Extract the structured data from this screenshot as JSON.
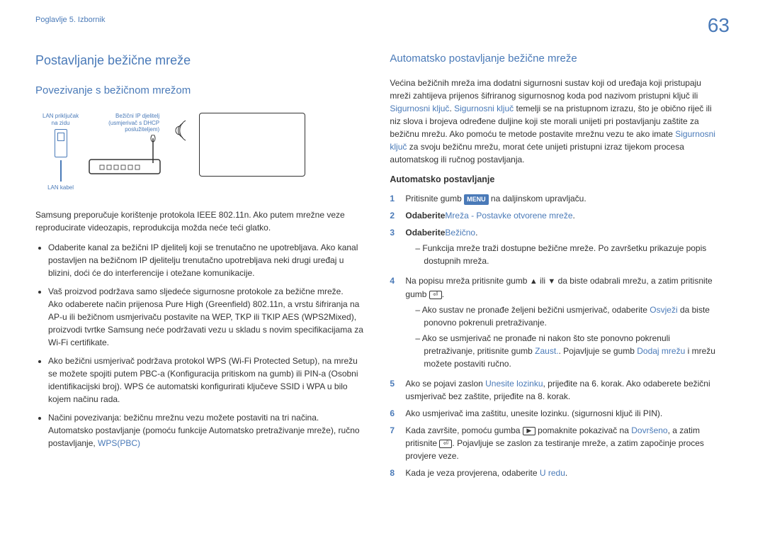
{
  "page_number": "63",
  "breadcrumb": "Poglavlje 5. Izbornik",
  "left": {
    "h1": "Postavljanje bežične mreže",
    "h2": "Povezivanje s bežičnom mrežom",
    "diagram": {
      "lan_wall": "LAN priključak",
      "lan_wall2": "na zidu",
      "router1": "Bežični IP djelitelj",
      "router2": "(usmjerivač s DHCP",
      "router3": "poslužiteljem)",
      "lan_cable": "LAN kabel"
    },
    "intro": "Samsung preporučuje korištenje protokola IEEE 802.11n. Ako putem mrežne veze reproducirate videozapis, reprodukcija možda neće teći glatko.",
    "bullets": [
      "Odaberite kanal za bežični IP djelitelj koji se trenutačno ne upotrebljava. Ako kanal postavljen na bežičnom IP djelitelju trenutačno upotrebljava neki drugi uređaj u blizini, doći će do interferencije i otežane komunikacije.",
      "Vaš proizvod podržava samo sljedeće sigurnosne protokole za bežične mreže.\nAko odaberete način prijenosa Pure High (Greenfield) 802.11n, a vrstu šifriranja na AP-u ili bežičnom usmjerivaču postavite na WEP, TKP ili TKIP AES (WPS2Mixed), proizvodi tvrtke Samsung neće podržavati vezu u skladu s novim specifikacijama za Wi-Fi certifikate.",
      "Ako bežični usmjerivač podržava protokol WPS (Wi-Fi Protected Setup), na mrežu se možete spojiti putem PBC-a (Konfiguracija pritiskom na gumb) ili PIN-a (Osobni identifikacijski broj). WPS će automatski konfigurirati ključeve SSID i WPA u bilo kojem načinu rada."
    ],
    "bullet4_pre": "Načini povezivanja: bežičnu mrežnu vezu možete postaviti na tri načina.\nAutomatsko postavljanje (pomoću funkcije Automatsko pretraživanje mreže), ručno postavljanje, ",
    "bullet4_hl": "WPS(PBC)"
  },
  "right": {
    "h2": "Automatsko postavljanje bežične mreže",
    "para_pre": "Većina bežičnih mreža ima dodatni sigurnosni sustav koji od uređaja koji pristupaju mreži zahtijeva prijenos šifriranog sigurnosnog koda pod nazivom pristupni ključ ili ",
    "para_hl1": "Sigurnosni ključ",
    "para_mid1": ". ",
    "para_hl2": "Sigurnosni ključ",
    "para_mid2": " temelji se na pristupnom izrazu, što je obično riječ ili niz slova i brojeva određene duljine koji ste morali unijeti pri postavljanju zaštite za bežičnu mrežu. Ako pomoću te metode postavite mrežnu vezu te ako imate ",
    "para_hl3": "Sigurnosni ključ",
    "para_end": " za svoju bežičnu mrežu, morat ćete unijeti pristupni izraz tijekom procesa automatskog ili ručnog postavljanja.",
    "h3": "Automatsko postavljanje",
    "step1_pre": "Pritisnite gumb ",
    "step1_btn": "MENU",
    "step1_post": " na daljinskom upravljaču.",
    "step2_bold": "Odaberite",
    "step2_hl": "Mreža",
    "step2_dash": " - ",
    "step2_hl2": "Postavke otvorene mreže",
    "step2_end": ".",
    "step3_bold": "Odaberite",
    "step3_hl": "Bežično",
    "step3_end": ".",
    "step3_dash": "Funkcija mreže traži dostupne bežične mreže. Po završetku prikazuje popis dostupnih mreža.",
    "step4_pre": "Na popisu mreža pritisnite gumb ",
    "step4_mid": " ili ",
    "step4_mid2": " da biste odabrali mrežu, a zatim pritisnite gumb ",
    "step4_post": ".",
    "step4_dash1_pre": "Ako sustav ne pronađe željeni bežični usmjerivač, odaberite ",
    "step4_dash1_hl": "Osvježi",
    "step4_dash1_post": " da biste ponovno pokrenuli pretraživanje.",
    "step4_dash2_pre": "Ako se usmjerivač ne pronađe ni nakon što ste ponovno pokrenuli pretraživanje, pritisnite gumb ",
    "step4_dash2_hl": "Zaust.",
    "step4_dash2_mid": ". Pojavljuje se gumb ",
    "step4_dash2_hl2": "Dodaj mrežu",
    "step4_dash2_post": " i mrežu možete postaviti ručno.",
    "step5_pre": "Ako se pojavi zaslon ",
    "step5_hl": "Unesite lozinku",
    "step5_post": ", prijeđite na 6. korak. Ako odaberete bežični usmjerivač bez zaštite, prijeđite na 8. korak.",
    "step6": "Ako usmjerivač ima zaštitu, unesite lozinku. (sigurnosni ključ ili PIN).",
    "step7_pre": "Kada završite, pomoću gumba ",
    "step7_mid": " pomaknite pokazivač na ",
    "step7_hl": "Dovršeno",
    "step7_mid2": ", a zatim pritisnite ",
    "step7_post": ". Pojavljuje se zaslon za testiranje mreže, a zatim započinje proces provjere veze.",
    "step8_pre": "Kada je veza provjerena, odaberite ",
    "step8_hl": "U redu",
    "step8_post": "."
  }
}
